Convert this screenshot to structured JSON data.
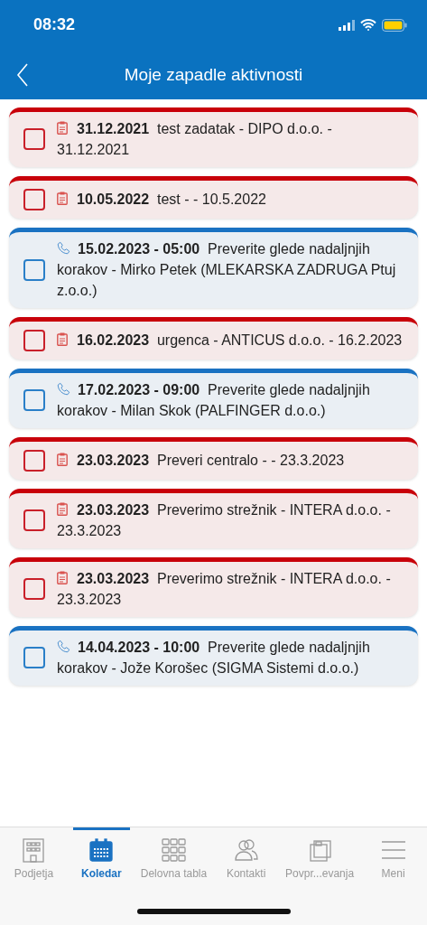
{
  "status_bar": {
    "time": "08:32"
  },
  "header": {
    "title": "Moje zapadle aktivnosti"
  },
  "activities": [
    {
      "kind": "task",
      "checked": false,
      "date": "31.12.2021",
      "text": "test zadatak - DIPO d.o.o. - 31.12.2021"
    },
    {
      "kind": "task",
      "checked": false,
      "date": "10.05.2022",
      "text": "test -  - 10.5.2022"
    },
    {
      "kind": "call",
      "checked": false,
      "date": "15.02.2023 - 05:00",
      "text": "Preverite glede nadaljnjih korakov - Mirko Petek (MLEKARSKA ZADRUGA Ptuj z.o.o.)"
    },
    {
      "kind": "task",
      "checked": false,
      "date": "16.02.2023",
      "text": "urgenca - ANTICUS d.o.o. - 16.2.2023"
    },
    {
      "kind": "call",
      "checked": false,
      "date": "17.02.2023 - 09:00",
      "text": "Preverite glede nadaljnjih korakov - Milan Skok (PALFINGER d.o.o.)"
    },
    {
      "kind": "task",
      "checked": false,
      "date": "23.03.2023",
      "text": "Preveri centralo -  - 23.3.2023"
    },
    {
      "kind": "task",
      "checked": false,
      "date": "23.03.2023",
      "text": "Preverimo strežnik - INTERA d.o.o. - 23.3.2023"
    },
    {
      "kind": "task",
      "checked": false,
      "date": "23.03.2023",
      "text": "Preverimo strežnik - INTERA d.o.o. - 23.3.2023"
    },
    {
      "kind": "call",
      "checked": false,
      "date": "14.04.2023 - 10:00",
      "text": "Preverite glede nadaljnjih korakov - Jože Korošec (SIGMA Sistemi d.o.o.)"
    }
  ],
  "tab_bar": [
    {
      "kind": "building",
      "label": "Podjetja",
      "selected": false
    },
    {
      "kind": "calendar",
      "label": "Koledar",
      "selected": true
    },
    {
      "kind": "grid",
      "label": "Delovna tabla",
      "selected": false
    },
    {
      "kind": "people",
      "label": "Kontakti",
      "selected": false
    },
    {
      "kind": "briefcase",
      "label": "Povpr...evanja",
      "selected": false
    },
    {
      "kind": "menu",
      "label": "Meni",
      "selected": false
    }
  ]
}
